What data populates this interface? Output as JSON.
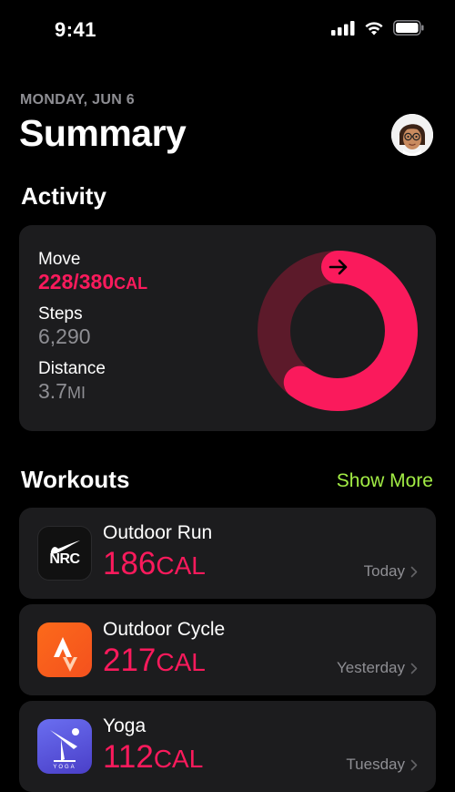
{
  "status_bar": {
    "time": "9:41"
  },
  "header": {
    "date": "MONDAY, JUN 6",
    "title": "Summary"
  },
  "activity": {
    "section_title": "Activity",
    "move_label": "Move",
    "move_value": "228/380",
    "move_unit": "CAL",
    "move_progress": 0.6,
    "steps_label": "Steps",
    "steps_value": "6,290",
    "distance_label": "Distance",
    "distance_value": "3.7",
    "distance_unit": "MI",
    "ring_color": "#fa1a5c",
    "ring_track_color": "#5c1a2a"
  },
  "workouts": {
    "section_title": "Workouts",
    "show_more": "Show More",
    "items": [
      {
        "name": "Outdoor Run",
        "value": "186",
        "unit": "CAL",
        "day": "Today",
        "app_text": "NRC"
      },
      {
        "name": "Outdoor Cycle",
        "value": "217",
        "unit": "CAL",
        "day": "Yesterday"
      },
      {
        "name": "Yoga",
        "value": "112",
        "unit": "CAL",
        "day": "Tuesday",
        "app_text": "YOGA"
      }
    ]
  },
  "colors": {
    "accent_red": "#fa1a5c",
    "accent_green": "#a2ec45",
    "card": "#1c1c1e"
  }
}
